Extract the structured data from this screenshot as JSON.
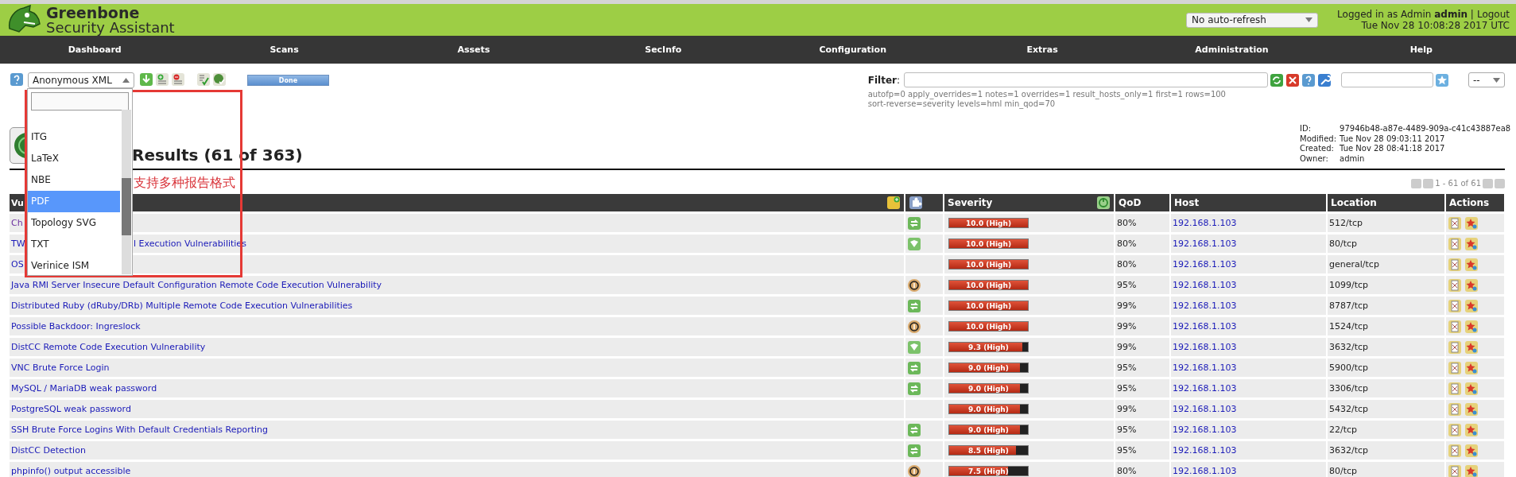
{
  "header": {
    "brand_line1": "Greenbone",
    "brand_line2": "Security Assistant",
    "refresh_select": "No auto-refresh",
    "login_text": "Logged in as  Admin  **admin** |",
    "logout": "Logout",
    "datetime": "Tue Nov 28 10:08:28 2017 UTC"
  },
  "nav": [
    "Dashboard",
    "Scans",
    "Assets",
    "SecInfo",
    "Configuration",
    "Extras",
    "Administration",
    "Help"
  ],
  "toolbar": {
    "format_select": "Anonymous XML",
    "status": "Done"
  },
  "format_dropdown": {
    "items": [
      {
        "label": "ITG",
        "selected": false
      },
      {
        "label": "LaTeX",
        "selected": false
      },
      {
        "label": "NBE",
        "selected": false
      },
      {
        "label": "PDF",
        "selected": true
      },
      {
        "label": "Topology SVG",
        "selected": false
      },
      {
        "label": "TXT",
        "selected": false
      },
      {
        "label": "Verinice ISM",
        "selected": false
      }
    ]
  },
  "annotation": {
    "text": "支持多种报告格式"
  },
  "filter": {
    "label": "**Filter**:",
    "summary": [
      "autofp=0 apply_overrides=1 notes=1 overrides=1 result_hosts_only=1 first=1 rows=100",
      "sort-reverse=severity levels=hml min_qod=70"
    ],
    "secondary_select": "--"
  },
  "report": {
    "title": "Results (61 of 363)",
    "details": [
      {
        "label": "ID:",
        "value": "97946b48-a87e-4489-909a-c41c43887ea8"
      },
      {
        "label": "Modified:",
        "value": "Tue Nov 28 09:03:11 2017"
      },
      {
        "label": "Created:",
        "value": "Tue Nov 28 08:41:18 2017"
      },
      {
        "label": "Owner:",
        "value": "admin"
      }
    ],
    "pagination": "1 - 61 of 61"
  },
  "table": {
    "columns": [
      "Vu",
      "Severity",
      "QoD",
      "Host",
      "Location",
      "Actions"
    ],
    "rows": [
      {
        "name": "Ch",
        "visited": true,
        "kind": "swap",
        "severity": "10.0 (High)",
        "level": 1.0,
        "qod": "80%",
        "host": "192.168.1.103",
        "location": "512/tcp"
      },
      {
        "name": "TW",
        "name_tail": "l Execution Vulnerabilities",
        "visited": false,
        "kind": "shield",
        "severity": "10.0 (High)",
        "level": 1.0,
        "qod": "80%",
        "host": "192.168.1.103",
        "location": "80/tcp"
      },
      {
        "name": "OS",
        "visited": false,
        "severity": "10.0 (High)",
        "level": 1.0,
        "qod": "80%",
        "host": "192.168.1.103",
        "location": "general/tcp"
      },
      {
        "name": "Java RMI Server Insecure Default Configuration Remote Code Execution Vulnerability",
        "visited": false,
        "kind": "ring",
        "severity": "10.0 (High)",
        "level": 1.0,
        "qod": "95%",
        "host": "192.168.1.103",
        "location": "1099/tcp"
      },
      {
        "name": "Distributed Ruby (dRuby/DRb) Multiple Remote Code Execution Vulnerabilities",
        "visited": false,
        "kind": "swap",
        "severity": "10.0 (High)",
        "level": 1.0,
        "qod": "99%",
        "host": "192.168.1.103",
        "location": "8787/tcp"
      },
      {
        "name": "Possible Backdoor: Ingreslock",
        "visited": false,
        "kind": "ring",
        "severity": "10.0 (High)",
        "level": 1.0,
        "qod": "99%",
        "host": "192.168.1.103",
        "location": "1524/tcp"
      },
      {
        "name": "DistCC Remote Code Execution Vulnerability",
        "visited": false,
        "kind": "shield",
        "severity": "9.3 (High)",
        "level": 0.93,
        "qod": "99%",
        "host": "192.168.1.103",
        "location": "3632/tcp"
      },
      {
        "name": "VNC Brute Force Login",
        "visited": false,
        "kind": "swap",
        "severity": "9.0 (High)",
        "level": 0.9,
        "qod": "95%",
        "host": "192.168.1.103",
        "location": "5900/tcp"
      },
      {
        "name": "MySQL / MariaDB weak password",
        "visited": false,
        "kind": "swap",
        "severity": "9.0 (High)",
        "level": 0.9,
        "qod": "95%",
        "host": "192.168.1.103",
        "location": "3306/tcp"
      },
      {
        "name": "PostgreSQL weak password",
        "visited": false,
        "severity": "9.0 (High)",
        "level": 0.9,
        "qod": "99%",
        "host": "192.168.1.103",
        "location": "5432/tcp"
      },
      {
        "name": "SSH Brute Force Logins With Default Credentials Reporting",
        "visited": false,
        "kind": "swap",
        "severity": "9.0 (High)",
        "level": 0.9,
        "qod": "95%",
        "host": "192.168.1.103",
        "location": "22/tcp"
      },
      {
        "name": "DistCC Detection",
        "visited": false,
        "kind": "swap",
        "severity": "8.5 (High)",
        "level": 0.85,
        "qod": "95%",
        "host": "192.168.1.103",
        "location": "3632/tcp"
      },
      {
        "name": "phpinfo() output accessible",
        "visited": false,
        "kind": "ring",
        "severity": "7.5 (High)",
        "level": 0.75,
        "qod": "80%",
        "host": "192.168.1.103",
        "location": "80/tcp"
      }
    ]
  }
}
